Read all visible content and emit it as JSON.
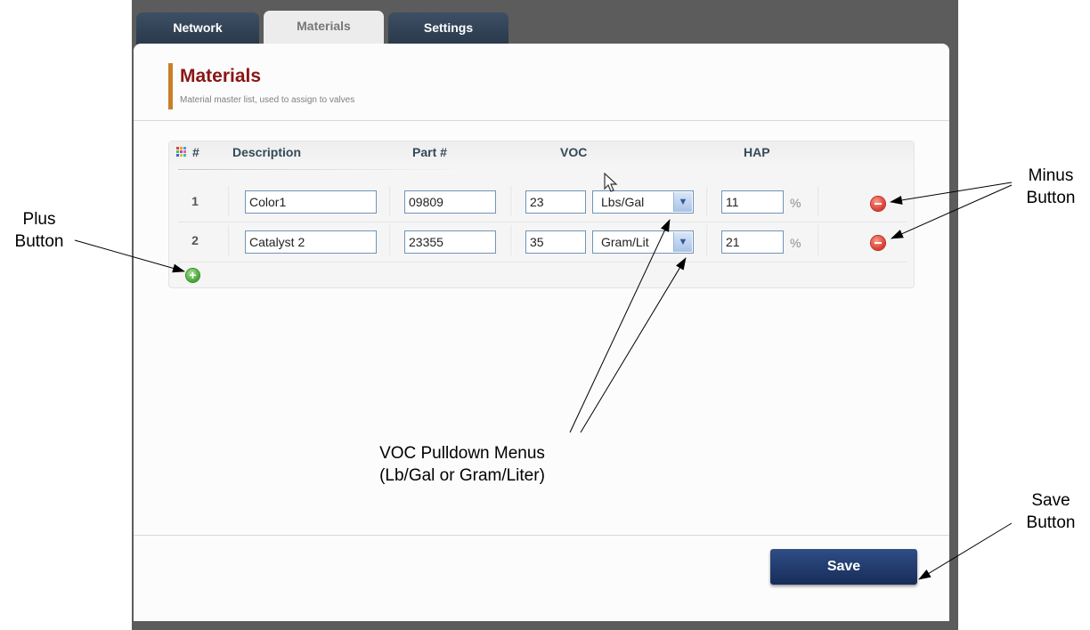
{
  "tabs": [
    {
      "label": "Network",
      "active": false
    },
    {
      "label": "Materials",
      "active": true
    },
    {
      "label": "Settings",
      "active": false
    }
  ],
  "header": {
    "title": "Materials",
    "subtitle": "Material master list, used to assign to valves"
  },
  "table": {
    "columns": {
      "num": "#",
      "description": "Description",
      "part": "Part #",
      "voc": "VOC",
      "hap": "HAP"
    },
    "rows": [
      {
        "num": "1",
        "description": "Color1",
        "part": "09809",
        "voc": "23",
        "voc_unit": "Lbs/Gal",
        "hap": "11",
        "hap_unit": "%"
      },
      {
        "num": "2",
        "description": "Catalyst 2",
        "part": "23355",
        "voc": "35",
        "voc_unit": "Gram/Lit",
        "hap": "21",
        "hap_unit": "%"
      }
    ]
  },
  "actions": {
    "save_label": "Save"
  },
  "callouts": {
    "plus": "Plus\nButton",
    "minus": "Minus\nButton",
    "voc": "VOC Pulldown Menus\n(Lb/Gal or Gram/Liter)",
    "save": "Save\nButton"
  },
  "colors": {
    "title": "#8a1616",
    "accent_bar": "#c8802a",
    "tab_dark": "#2f4055",
    "save_button": "#1f3a6e",
    "minus": "#d63a2e",
    "plus": "#3fa22e"
  },
  "icons": [
    "grid-icon",
    "plus-icon",
    "minus-icon",
    "chevron-down-icon",
    "cursor-icon"
  ]
}
